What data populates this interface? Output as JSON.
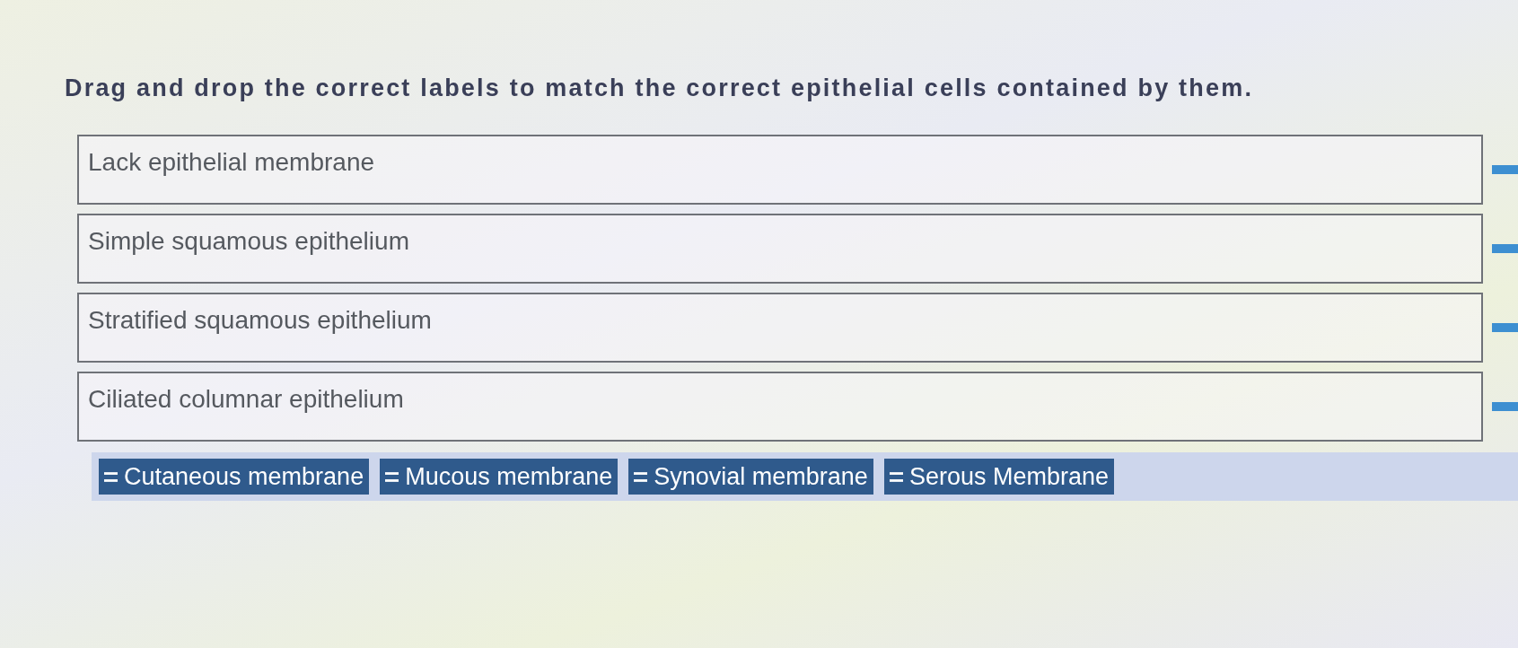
{
  "question": {
    "prompt": "Drag and drop the correct labels to match the correct epithelial cells contained by them."
  },
  "drop_zones": [
    {
      "label": "Lack epithelial membrane"
    },
    {
      "label": "Simple squamous epithelium"
    },
    {
      "label": "Stratified squamous epithelium"
    },
    {
      "label": "Ciliated columnar epithelium"
    }
  ],
  "label_bank": [
    {
      "label": "Cutaneous membrane"
    },
    {
      "label": "Mucous membrane"
    },
    {
      "label": "Synovial membrane"
    },
    {
      "label": "Serous Membrane"
    }
  ]
}
